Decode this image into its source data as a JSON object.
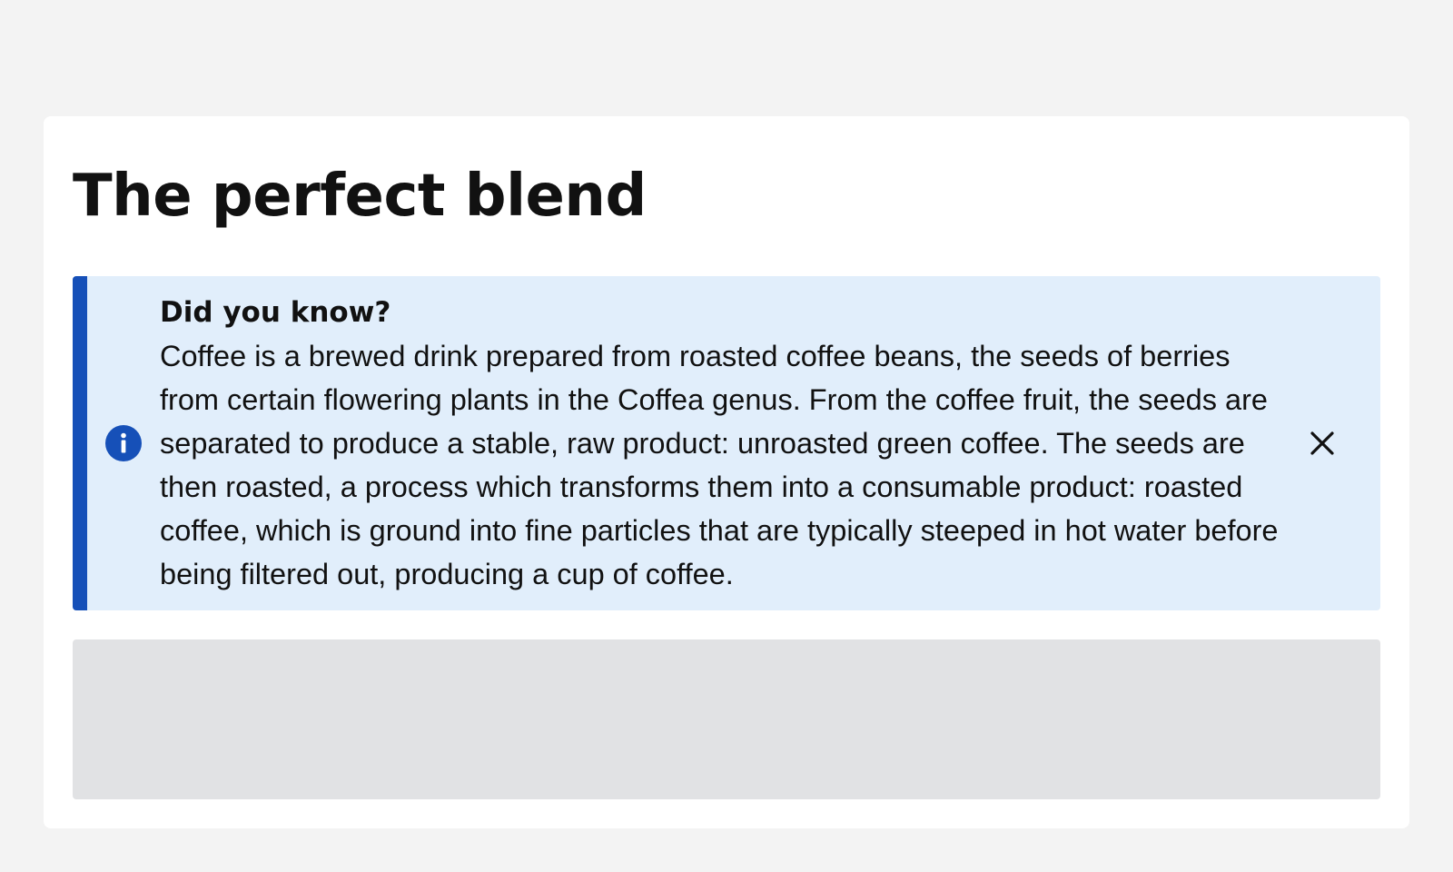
{
  "page": {
    "title": "The perfect blend"
  },
  "alert": {
    "variant": "info",
    "heading": "Did you know?",
    "body": "Coffee is a brewed drink prepared from roasted coffee beans, the seeds of berries from certain flowering plants in the Coffea genus. From the coffee fruit, the seeds are separated to produce a stable, raw product: unroasted green coffee. The seeds are then roasted, a process which transforms them into a consumable product: roasted coffee, which is ground into fine particles that are typically steeped in hot water before being filtered out, producing a cup of coffee.",
    "icon": "info-circle-icon",
    "close_icon": "close-icon"
  },
  "colors": {
    "page_background": "#f3f3f3",
    "card_background": "#ffffff",
    "alert_background": "#e1eefb",
    "alert_accent": "#1650b8",
    "placeholder": "#e1e2e4",
    "text": "#111111"
  }
}
